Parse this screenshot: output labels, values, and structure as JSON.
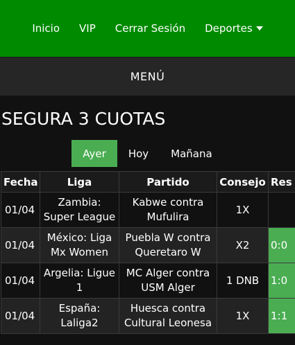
{
  "nav": {
    "items": [
      "Inicio",
      "VIP",
      "Cerrar Sesión"
    ],
    "dropdown_label": "Deportes"
  },
  "menu_label": "MENÚ",
  "page_title": "SEGURA 3 CUOTAS",
  "tabs": [
    "Ayer",
    "Hoy",
    "Mañana"
  ],
  "active_tab": "Ayer",
  "table": {
    "headers": [
      "Fecha",
      "Liga",
      "Partido",
      "Consejo",
      "Res"
    ],
    "rows": [
      {
        "fecha": "01/04",
        "liga": "Zambia: Super League",
        "partido": "Kabwe contra Mufulira",
        "consejo": "1X",
        "res": ""
      },
      {
        "fecha": "01/04",
        "liga": "México: Liga Mx Women",
        "partido": "Puebla W contra Queretaro W",
        "consejo": "X2",
        "res": "0:0"
      },
      {
        "fecha": "01/04",
        "liga": "Argelia: Ligue 1",
        "partido": "MC Alger contra USM Alger",
        "consejo": "1 DNB",
        "res": "1:0"
      },
      {
        "fecha": "01/04",
        "liga": "España: Laliga2",
        "partido": "Huesca contra Cultural Leonesa",
        "consejo": "1X",
        "res": "1:1"
      }
    ]
  },
  "colors": {
    "nav_green": "#008a00",
    "accent_green": "#4aad52",
    "menubar": "#262626",
    "background": "#111111"
  }
}
